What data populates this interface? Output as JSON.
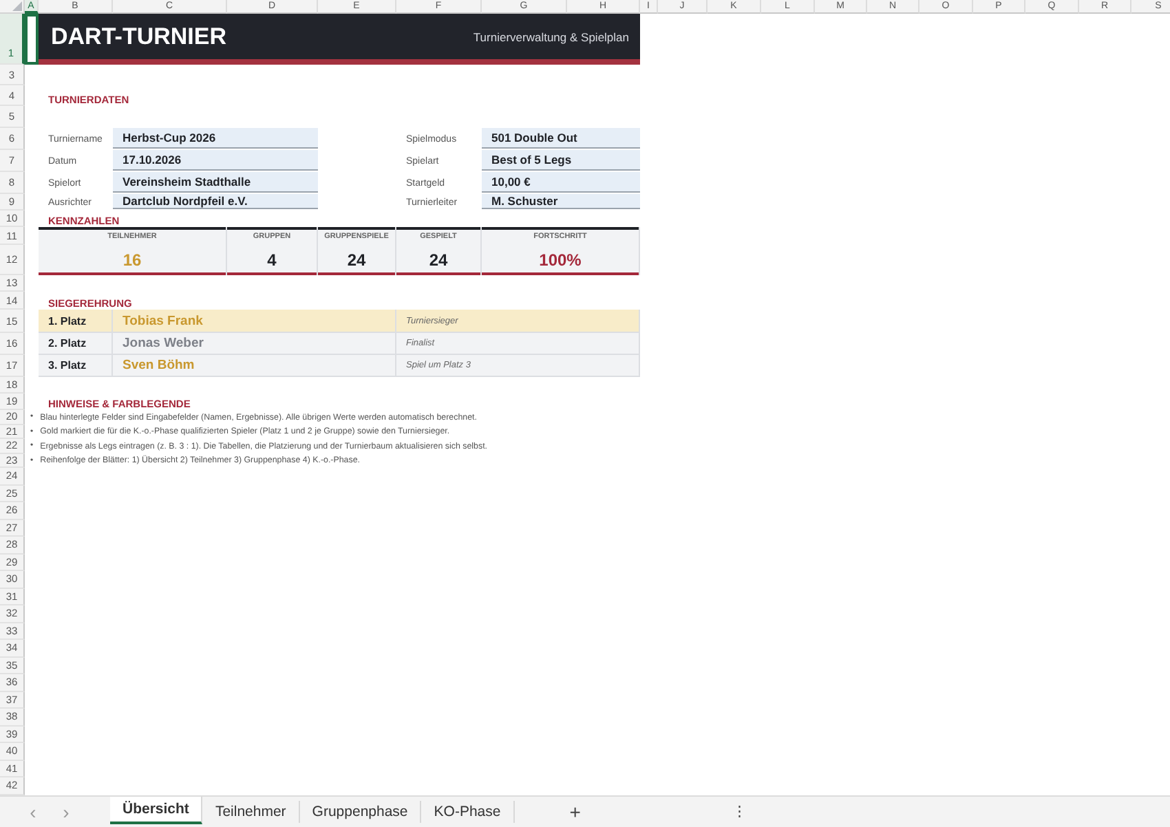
{
  "columns": [
    {
      "label": "A",
      "selected": true
    },
    {
      "label": "B",
      "selected": false
    },
    {
      "label": "C",
      "selected": false
    },
    {
      "label": "D",
      "selected": false
    },
    {
      "label": "E",
      "selected": false
    },
    {
      "label": "F",
      "selected": false
    },
    {
      "label": "G",
      "selected": false
    },
    {
      "label": "H",
      "selected": false
    },
    {
      "label": "I",
      "selected": false
    },
    {
      "label": "J",
      "selected": false
    },
    {
      "label": "K",
      "selected": false
    },
    {
      "label": "L",
      "selected": false
    },
    {
      "label": "M",
      "selected": false
    },
    {
      "label": "N",
      "selected": false
    },
    {
      "label": "O",
      "selected": false
    },
    {
      "label": "P",
      "selected": false
    },
    {
      "label": "Q",
      "selected": false
    },
    {
      "label": "R",
      "selected": false
    },
    {
      "label": "S",
      "selected": false
    }
  ],
  "rows": [
    {
      "label": "1",
      "selected": true
    },
    {
      "label": "3",
      "selected": false
    },
    {
      "label": "4",
      "selected": false
    },
    {
      "label": "5",
      "selected": false
    },
    {
      "label": "6",
      "selected": false
    },
    {
      "label": "7",
      "selected": false
    },
    {
      "label": "8",
      "selected": false
    },
    {
      "label": "9",
      "selected": false
    },
    {
      "label": "10",
      "selected": false
    },
    {
      "label": "11",
      "selected": false
    },
    {
      "label": "12",
      "selected": false
    },
    {
      "label": "13",
      "selected": false
    },
    {
      "label": "14",
      "selected": false
    },
    {
      "label": "15",
      "selected": false
    },
    {
      "label": "16",
      "selected": false
    },
    {
      "label": "17",
      "selected": false
    },
    {
      "label": "18",
      "selected": false
    },
    {
      "label": "19",
      "selected": false
    },
    {
      "label": "20",
      "selected": false
    },
    {
      "label": "21",
      "selected": false
    },
    {
      "label": "22",
      "selected": false
    },
    {
      "label": "23",
      "selected": false
    },
    {
      "label": "24",
      "selected": false
    },
    {
      "label": "25",
      "selected": false
    },
    {
      "label": "26",
      "selected": false
    },
    {
      "label": "27",
      "selected": false
    },
    {
      "label": "28",
      "selected": false
    },
    {
      "label": "29",
      "selected": false
    },
    {
      "label": "30",
      "selected": false
    },
    {
      "label": "31",
      "selected": false
    },
    {
      "label": "32",
      "selected": false
    },
    {
      "label": "33",
      "selected": false
    },
    {
      "label": "34",
      "selected": false
    },
    {
      "label": "35",
      "selected": false
    },
    {
      "label": "36",
      "selected": false
    },
    {
      "label": "37",
      "selected": false
    },
    {
      "label": "38",
      "selected": false
    },
    {
      "label": "39",
      "selected": false
    },
    {
      "label": "40",
      "selected": false
    },
    {
      "label": "41",
      "selected": false
    },
    {
      "label": "42",
      "selected": false
    }
  ],
  "banner": {
    "title": "DART-TURNIER",
    "subtitle": "Turnierverwaltung & Spielplan"
  },
  "tournament": {
    "heading": "TURNIERDATEN",
    "fields": [
      {
        "label": "Turniername",
        "value": "Herbst-Cup 2026"
      },
      {
        "label": "Spielmodus",
        "value": "501 Double Out"
      },
      {
        "label": "Datum",
        "value": "17.10.2026"
      },
      {
        "label": "Spielart",
        "value": "Best of 5 Legs"
      },
      {
        "label": "Spielort",
        "value": "Vereinsheim Stadthalle"
      },
      {
        "label": "Startgeld",
        "value": "10,00 €"
      },
      {
        "label": "Ausrichter",
        "value": "Dartclub Nordpfeil e.V."
      },
      {
        "label": "Turnierleiter",
        "value": "M. Schuster"
      }
    ]
  },
  "kpis": {
    "heading": "KENNZAHLEN",
    "items": [
      {
        "label": "TEILNEHMER",
        "value": "16",
        "color": "#c9982f"
      },
      {
        "label": "GRUPPEN",
        "value": "4",
        "color": "#1f2126"
      },
      {
        "label": "GRUPPENSPIELE",
        "value": "24",
        "color": "#1f2126"
      },
      {
        "label": "GESPIELT",
        "value": "24",
        "color": "#1f2126"
      },
      {
        "label": "FORTSCHRITT",
        "value": "100%",
        "color": "#a4283a"
      }
    ]
  },
  "podium": {
    "heading": "SIEGEREHRUNG",
    "places": [
      {
        "place": "1. Platz",
        "name": "Tobias Frank",
        "note": "Turniersieger",
        "highlighted": true,
        "color": "#c9982f"
      },
      {
        "place": "2. Platz",
        "name": "Jonas Weber",
        "note": "Finalist",
        "highlighted": false,
        "color": "#7d8088"
      },
      {
        "place": "3. Platz",
        "name": "Sven Böhm",
        "note": "Spiel um Platz 3",
        "highlighted": false,
        "color": "#c9982f"
      }
    ]
  },
  "notes": {
    "heading": "HINWEISE & FARBLEGENDE",
    "items": [
      {
        "marker": "•",
        "text": "Blau hinterlegte Felder sind Eingabefelder (Namen, Ergebnisse). Alle übrigen Werte werden automatisch berechnet."
      },
      {
        "marker": "•",
        "text": "Gold markiert die für die K.-o.-Phase qualifizierten Spieler (Platz 1 und 2 je Gruppe) sowie den Turniersieger."
      },
      {
        "marker": "•",
        "text": "Ergebnisse als Legs eintragen (z. B. 3 : 1). Die Tabellen, die Platzierung und der Turnierbaum aktualisieren sich selbst."
      },
      {
        "marker": "•",
        "text": "Reihenfolge der Blätter: 1) Übersicht  2) Teilnehmer  3) Gruppenphase  4) K.-o.-Phase."
      }
    ]
  },
  "sheet_bar": {
    "prev": "‹",
    "next": "›",
    "add": "+",
    "more": "⋮",
    "tabs": [
      {
        "label": "Übersicht",
        "selected": true
      },
      {
        "label": "Teilnehmer",
        "selected": false
      },
      {
        "label": "Gruppenphase",
        "selected": false
      },
      {
        "label": "KO-Phase",
        "selected": false
      }
    ]
  }
}
